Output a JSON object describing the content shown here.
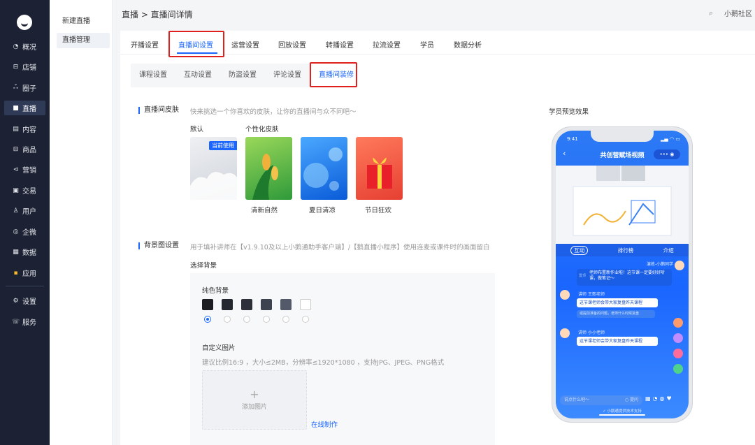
{
  "sidebar": {
    "items": [
      {
        "label": "概况",
        "icon": "◔"
      },
      {
        "label": "店铺",
        "icon": "⊟"
      },
      {
        "label": "圈子",
        "icon": "ஃ"
      },
      {
        "label": "直播",
        "icon": "■"
      },
      {
        "label": "内容",
        "icon": "▤"
      },
      {
        "label": "商品",
        "icon": "⊟"
      },
      {
        "label": "营销",
        "icon": "⊲"
      },
      {
        "label": "交易",
        "icon": "▣"
      },
      {
        "label": "用户",
        "icon": "♙"
      },
      {
        "label": "企微",
        "icon": "◎"
      },
      {
        "label": "数据",
        "icon": "▦"
      },
      {
        "label": "应用",
        "icon": "▪"
      },
      {
        "label": "设置",
        "icon": "⚙"
      },
      {
        "label": "服务",
        "icon": "☏"
      }
    ]
  },
  "subnav": {
    "new_live": "新建直播",
    "live_manage": "直播管理"
  },
  "header": {
    "breadcrumb": "直播 > 直播间详情",
    "shop": "小鹅社区"
  },
  "tabs": [
    "开播设置",
    "直播间设置",
    "运营设置",
    "回放设置",
    "转播设置",
    "拉流设置",
    "学员",
    "数据分析"
  ],
  "subtabs": [
    "课程设置",
    "互动设置",
    "防盗设置",
    "评论设置",
    "直播间装修"
  ],
  "skin": {
    "title": "直播间皮肤",
    "hint": "快来挑选一个你喜欢的皮肤，让你的直播间与众不同吧～",
    "default_label": "默认",
    "custom_label": "个性化皮肤",
    "badge": "当前使用",
    "names": [
      "清新自然",
      "夏日清凉",
      "节日狂欢"
    ]
  },
  "background": {
    "title": "背景图设置",
    "hint": "用于填补讲师在【v1.9.10及以上小鹅通助手客户端】/【鹅直播小程序】使用连麦或课件时的画面留白",
    "select_label": "选择背景",
    "solid_label": "纯色背景",
    "colors": [
      "#1b1d22",
      "#24272f",
      "#2d3039",
      "#3e4350",
      "#545a69",
      "#ffffff"
    ],
    "custom_label": "自定义图片",
    "custom_hint": "建议比例16:9 ，大小≤2MB，分辨率≤1920*1080 ，支持JPG、JPEG、PNG格式",
    "upload_label": "添加图片",
    "online_label": "在线制作"
  },
  "preview": {
    "title": "学员预览效果",
    "time": "9:41",
    "room_title": "共创营赋场视频",
    "tab_interact": "互动",
    "tab_rank": "排行榜",
    "tab_intro": "介绍",
    "msg1_name": "演练-小鹅同学",
    "msg1_tag": "置顶",
    "msg1_text": "老师布置新作业啦！这节课一定要好好听课，做笔记～",
    "msg2_name": "王熙老师",
    "msg2_tag": "讲师",
    "msg2_text": "这节课老师会带大家复盘昨天课程",
    "msg2_sub": "或提前准备的问题，老师什么时候复盘",
    "msg3_name": "小小老师",
    "msg3_tag": "讲师",
    "msg3_text": "这节课老师会带大家复盘昨天课程",
    "input_placeholder": "说点什么吧～",
    "input_extra": "○ 提问",
    "footer": "小鹅通提供技术支持"
  }
}
